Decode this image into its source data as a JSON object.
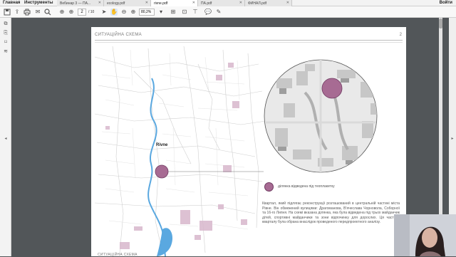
{
  "menu": {
    "home": "Главная",
    "tools": "Инструменты",
    "sign_in": "Войти"
  },
  "tabs": [
    {
      "label": "Вебинар 3 — ПА..."
    },
    {
      "label": "ecology.pdf"
    },
    {
      "label": "rivne.pdf"
    },
    {
      "label": "ПА.pdf"
    },
    {
      "label": "ФИНАЛ.pdf"
    }
  ],
  "toolbar": {
    "page_current": "2",
    "page_total": "/ 10",
    "zoom": "80,2%",
    "icons": [
      "save-icon",
      "print-icon",
      "search-icon",
      "prev-page-icon",
      "next-page-icon",
      "select-icon",
      "hand-icon",
      "zoom-out-icon",
      "zoom-in-icon",
      "fit-page-icon",
      "scroll-mode-icon",
      "stamp-icon",
      "comment-icon",
      "pen-icon",
      "share-icon"
    ]
  },
  "sidebar": {
    "icons": [
      "thumbnails-icon",
      "attachments-icon",
      "bookmarks-icon",
      "layers-icon"
    ]
  },
  "document": {
    "header_title": "СИТУАЦІЙНА СХЕМА",
    "page_number": "2",
    "map_label": "Rivne",
    "legend_text": "ділянка відведена під теоплакетку",
    "description": "Квартал, який підлягає реконструкції розташований в центральній частині міста Рівне. Він обмежений вулицями: Драгоманова, В'ячеслава Чорновола, Соборної та 16-го Липня. На схемі вказана ділянка, яка була відведена під трьох майданчик дітей, спортивні майданчики та зони відпочинку для дорослих. Ця частина кварталу була обрана внаслідок проведеного передпроектного аналізу.",
    "next_page_title": "СИТУАЦІЙНА СХЕМА"
  },
  "colors": {
    "accent": "#a76b93",
    "river": "#5aa8e0",
    "toolbar_highlight": "#1473e6"
  }
}
